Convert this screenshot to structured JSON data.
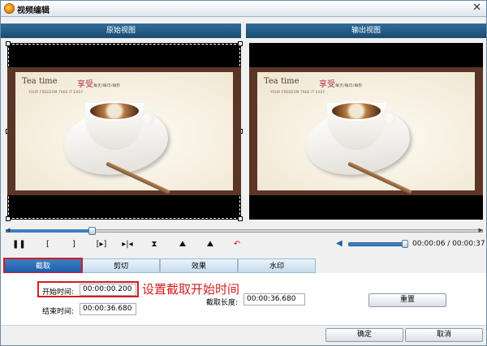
{
  "window": {
    "title": "视频编辑",
    "close_glyph": "✕"
  },
  "views": {
    "original_label": "原始视图",
    "output_label": "输出视图"
  },
  "preview_card": {
    "title": "Tea time",
    "tagline": "YOUR FREEDOM TAKE IT EASY",
    "brand": "享受",
    "brand_small": "每天/每日/每秒"
  },
  "timeline": {
    "progress": 0.18
  },
  "controls": [
    {
      "name": "pause-button",
      "glyph": "❚❚"
    },
    {
      "name": "mark-in-button",
      "glyph": "["
    },
    {
      "name": "mark-out-button",
      "glyph": "]"
    },
    {
      "name": "play-selection-button",
      "glyph": "[▸]"
    },
    {
      "name": "next-frame-button",
      "glyph": "▸|◂"
    },
    {
      "name": "flip-vertical-button",
      "glyph": "⧗"
    },
    {
      "name": "rotate-left-button",
      "glyph": "⛰"
    },
    {
      "name": "rotate-right-button",
      "glyph": "⛰"
    },
    {
      "name": "undo-button",
      "glyph": "↶"
    }
  ],
  "volume": {
    "level": 1.0,
    "icon": "speaker-icon"
  },
  "playback_time": "00:00:06 / 00:00:37",
  "tabs": [
    {
      "label": "截取",
      "active": true
    },
    {
      "label": "剪切",
      "active": false
    },
    {
      "label": "效果",
      "active": false
    },
    {
      "label": "水印",
      "active": false
    }
  ],
  "trim": {
    "start_label": "开始时间:",
    "start_value": "00:00:00.200",
    "end_label": "结束时间:",
    "end_value": "00:00:36.680",
    "length_label": "截取长度:",
    "length_value": "00:00:36.680",
    "reset_label": "重置"
  },
  "annotation": "设置截取开始时间",
  "footer": {
    "ok_label": "确定",
    "cancel_label": "取消"
  },
  "colors": {
    "accent": "#1f5da8",
    "highlight": "#d31e1e",
    "header": "#1b4c72"
  }
}
